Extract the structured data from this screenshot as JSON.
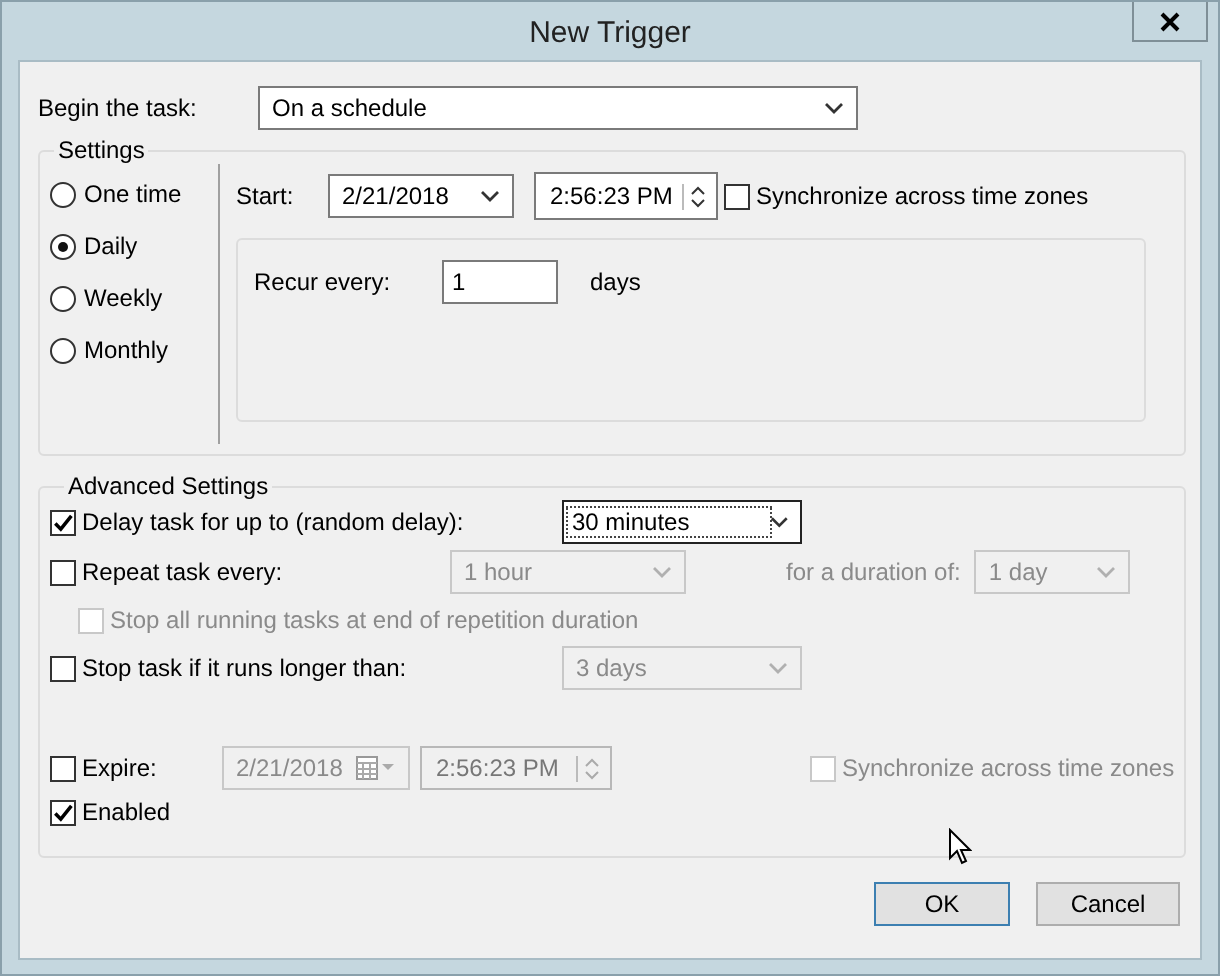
{
  "window": {
    "title": "New Trigger"
  },
  "begin": {
    "label": "Begin the task:",
    "value": "On a schedule"
  },
  "settings": {
    "title": "Settings",
    "schedules": [
      {
        "label": "One time",
        "selected": false
      },
      {
        "label": "Daily",
        "selected": true
      },
      {
        "label": "Weekly",
        "selected": false
      },
      {
        "label": "Monthly",
        "selected": false
      }
    ],
    "start_label": "Start:",
    "date": "2/21/2018",
    "time": "2:56:23 PM",
    "sync": {
      "label": "Synchronize across time zones",
      "checked": false
    },
    "recur_label": "Recur every:",
    "recur_value": "1",
    "recur_unit": "days"
  },
  "advanced": {
    "title": "Advanced Settings",
    "delay": {
      "label": "Delay task for up to (random delay):",
      "checked": true,
      "value": "30 minutes",
      "disabled": false
    },
    "repeat": {
      "label": "Repeat task every:",
      "checked": false,
      "value": "1 hour",
      "disabled": true,
      "duration_label": "for a duration of:",
      "duration_value": "1 day"
    },
    "stop_all": {
      "label": "Stop all running tasks at end of repetition duration",
      "checked": false,
      "disabled": true
    },
    "stop_long": {
      "label": "Stop task if it runs longer than:",
      "checked": false,
      "value": "3 days",
      "disabled": true
    },
    "expire": {
      "label": "Expire:",
      "checked": false,
      "date": "2/21/2018",
      "time": "2:56:23 PM",
      "disabled": true
    },
    "expire_sync": {
      "label": "Synchronize across time zones",
      "checked": false,
      "disabled": true
    },
    "enabled": {
      "label": "Enabled",
      "checked": true
    }
  },
  "buttons": [
    {
      "label": "OK",
      "default": true
    },
    {
      "label": "Cancel",
      "default": false
    }
  ]
}
